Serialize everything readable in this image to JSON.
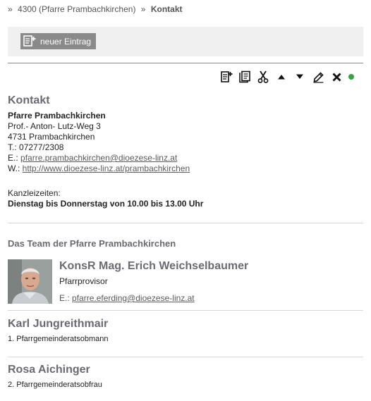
{
  "breadcrumb": {
    "sep": "»",
    "parent": "4300 (Pfarre Prambachkirchen)",
    "current": "Kontakt"
  },
  "toolbar": {
    "new_entry_label": "neuer Eintrag",
    "icons": [
      "add-entry-icon",
      "copy-icon",
      "cut-icon",
      "move-up-icon",
      "move-down-icon",
      "edit-icon",
      "delete-icon",
      "status-active-icon"
    ],
    "status_color": "#2ea83a"
  },
  "contact": {
    "title": "Kontakt",
    "name": "Pfarre Prambachkirchen",
    "street": "Prof.- Anton- Lutz-Weg 3",
    "city": "4731 Prambachkirchen",
    "phone_prefix": "T.: ",
    "phone": "07277/2308",
    "email_prefix": "E.: ",
    "email": "pfarre.prambachkirchen@dioezese-linz.at",
    "web_prefix": "W.: ",
    "web": "http://www.dioezese-linz.at/prambachkirchen",
    "hours_label": "Kanzleizeiten:",
    "hours": "Dienstag bis Donnerstag von 10.00 bis 13.00 Uhr"
  },
  "team": {
    "title": "Das Team der Pfarre Prambachkirchen",
    "members": [
      {
        "name": "KonsR Mag. Erich Weichselbaumer",
        "role": "Pfarrprovisor",
        "email_prefix": "E.: ",
        "email": "pfarre.eferding@dioezese-linz.at"
      },
      {
        "name": "Karl Jungreithmair",
        "role": "1. Pfarrgemeinderatsobmann"
      },
      {
        "name": "Rosa Aichinger",
        "role": "2. Pfarrgemeinderatsobfrau"
      }
    ]
  }
}
